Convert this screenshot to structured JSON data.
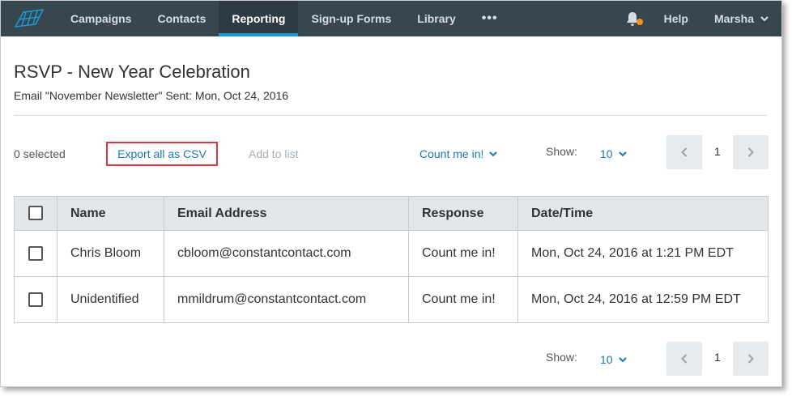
{
  "nav": {
    "items": [
      {
        "label": "Campaigns",
        "active": false
      },
      {
        "label": "Contacts",
        "active": false
      },
      {
        "label": "Reporting",
        "active": true
      },
      {
        "label": "Sign-up Forms",
        "active": false
      },
      {
        "label": "Library",
        "active": false
      }
    ],
    "more_label": "•••",
    "help_label": "Help",
    "user_label": "Marsha",
    "icons": {
      "logo": "brand-logo-icon",
      "bell": "bell-icon",
      "notification_dot_color": "#f7941d"
    }
  },
  "header": {
    "title": "RSVP - New Year Celebration",
    "subtitle": "Email \"November Newsletter\" Sent: Mon, Oct 24, 2016"
  },
  "toolbar": {
    "selected_count": "0 selected",
    "export_label": "Export all as CSV",
    "add_to_list_label": "Add to list",
    "response_filter": "Count me in!",
    "show_label": "Show:",
    "show_value": "10",
    "current_page": "1"
  },
  "table": {
    "columns": [
      "Name",
      "Email Address",
      "Response",
      "Date/Time"
    ],
    "rows": [
      {
        "name": "Chris Bloom",
        "email": "cbloom@constantcontact.com",
        "response": "Count me in!",
        "datetime": "Mon, Oct 24, 2016 at 1:21 PM EDT"
      },
      {
        "name": "Unidentified",
        "email": "mmildrum@constantcontact.com",
        "response": "Count me in!",
        "datetime": "Mon, Oct 24, 2016 at 12:59 PM EDT"
      }
    ]
  },
  "footer": {
    "show_label": "Show:",
    "show_value": "10",
    "current_page": "1"
  },
  "colors": {
    "nav_bg": "#37474f",
    "active_underline": "#1a9ad8",
    "link_blue": "#1a79b6",
    "highlight_border": "#d9363e"
  }
}
